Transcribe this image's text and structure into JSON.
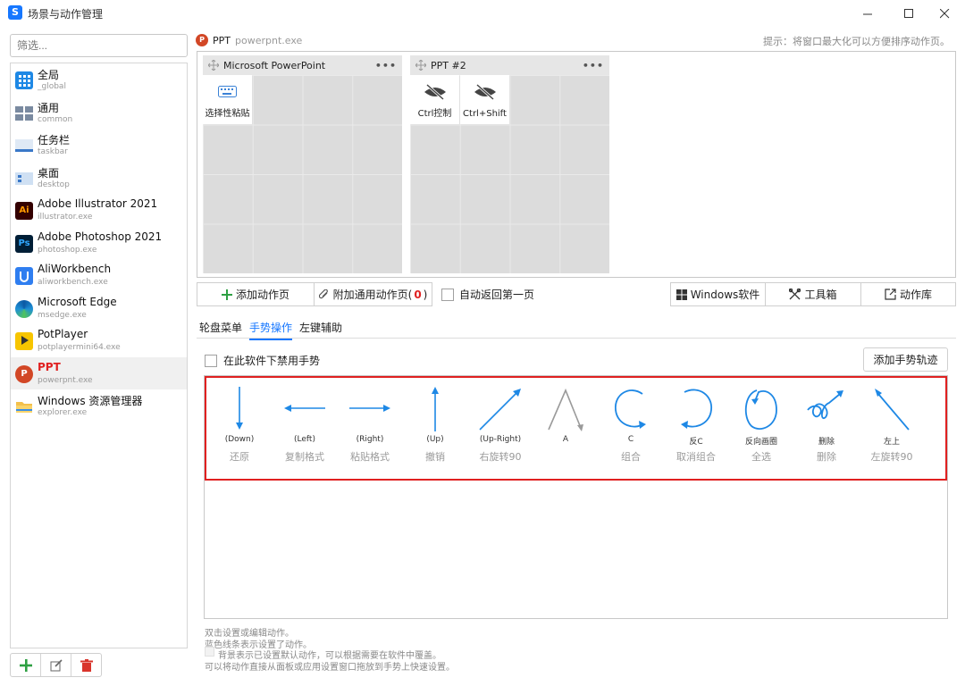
{
  "window": {
    "title": "场景与动作管理"
  },
  "sidebar": {
    "filter_placeholder": "筛选...",
    "apps": [
      {
        "name": "全局",
        "sub": "_global",
        "icon": "global-grid-icon"
      },
      {
        "name": "通用",
        "sub": "common",
        "icon": "common-grid-icon"
      },
      {
        "name": "任务栏",
        "sub": "taskbar",
        "icon": "taskbar-icon"
      },
      {
        "name": "桌面",
        "sub": "desktop",
        "icon": "desktop-icon"
      },
      {
        "name": "Adobe Illustrator 2021",
        "sub": "illustrator.exe",
        "icon": "illustrator-icon"
      },
      {
        "name": "Adobe Photoshop 2021",
        "sub": "photoshop.exe",
        "icon": "photoshop-icon"
      },
      {
        "name": "AliWorkbench",
        "sub": "aliworkbench.exe",
        "icon": "aliworkbench-icon"
      },
      {
        "name": "Microsoft Edge",
        "sub": "msedge.exe",
        "icon": "edge-icon"
      },
      {
        "name": "PotPlayer",
        "sub": "potplayermini64.exe",
        "icon": "potplayer-icon"
      },
      {
        "name": "PPT",
        "sub": "powerpnt.exe",
        "icon": "ppt-icon",
        "selected": true
      },
      {
        "name": "Windows 资源管理器",
        "sub": "explorer.exe",
        "icon": "explorer-icon"
      }
    ],
    "selected_badge_colors": {
      "ai": "#ff9a00",
      "ps": "#31a8ff"
    }
  },
  "header": {
    "app_name": "PPT",
    "exe": "powerpnt.exe",
    "hint": "提示：将窗口最大化可以方便排序动作页。"
  },
  "panels": [
    {
      "title": "Microsoft PowerPoint",
      "more": "•••",
      "tiles": [
        {
          "label": "选择性粘贴",
          "icon": "keyboard-icon"
        }
      ]
    },
    {
      "title": "PPT #2",
      "more": "•••",
      "tiles": [
        {
          "label": "Ctrl控制",
          "icon": "hidden-eye-icon"
        },
        {
          "label": "Ctrl+Shift",
          "icon": "hidden-eye-icon"
        }
      ]
    }
  ],
  "actions": {
    "add_page": "添加动作页",
    "attach_common_pre": "附加通用动作页(",
    "attach_common_count": "0",
    "attach_common_post": ")",
    "auto_return": "自动返回第一页",
    "windows_software": "Windows软件",
    "toolbox": "工具箱",
    "action_library": "动作库"
  },
  "tabs": [
    {
      "label": "轮盘菜单"
    },
    {
      "label": "手势操作",
      "active": true
    },
    {
      "label": "左键辅助"
    }
  ],
  "gestures_section": {
    "disable_label": "在此软件下禁用手势",
    "add_button": "添加手势轨迹",
    "items": [
      {
        "name": "(Down)",
        "action": "还原"
      },
      {
        "name": "(Left)",
        "action": "复制格式"
      },
      {
        "name": "(Right)",
        "action": "粘贴格式"
      },
      {
        "name": "(Up)",
        "action": "撤销"
      },
      {
        "name": "(Up-Right)",
        "action": "右旋转90"
      },
      {
        "name": "A",
        "action": ""
      },
      {
        "name": "C",
        "action": "组合"
      },
      {
        "name": "反C",
        "action": "取消组合"
      },
      {
        "name": "反向画圈",
        "action": "全选"
      },
      {
        "name": "删除",
        "action": "删除"
      },
      {
        "name": "左上",
        "action": "左旋转90"
      }
    ],
    "stroke_color": "#1e88e5"
  },
  "footer": {
    "line1": "双击设置或编辑动作。",
    "line2": "蓝色线条表示设置了动作。",
    "line3": "背景表示已设置默认动作，可以根据需要在软件中覆盖。",
    "line4": "可以将动作直接从面板或应用设置窗口拖放到手势上快速设置。"
  }
}
